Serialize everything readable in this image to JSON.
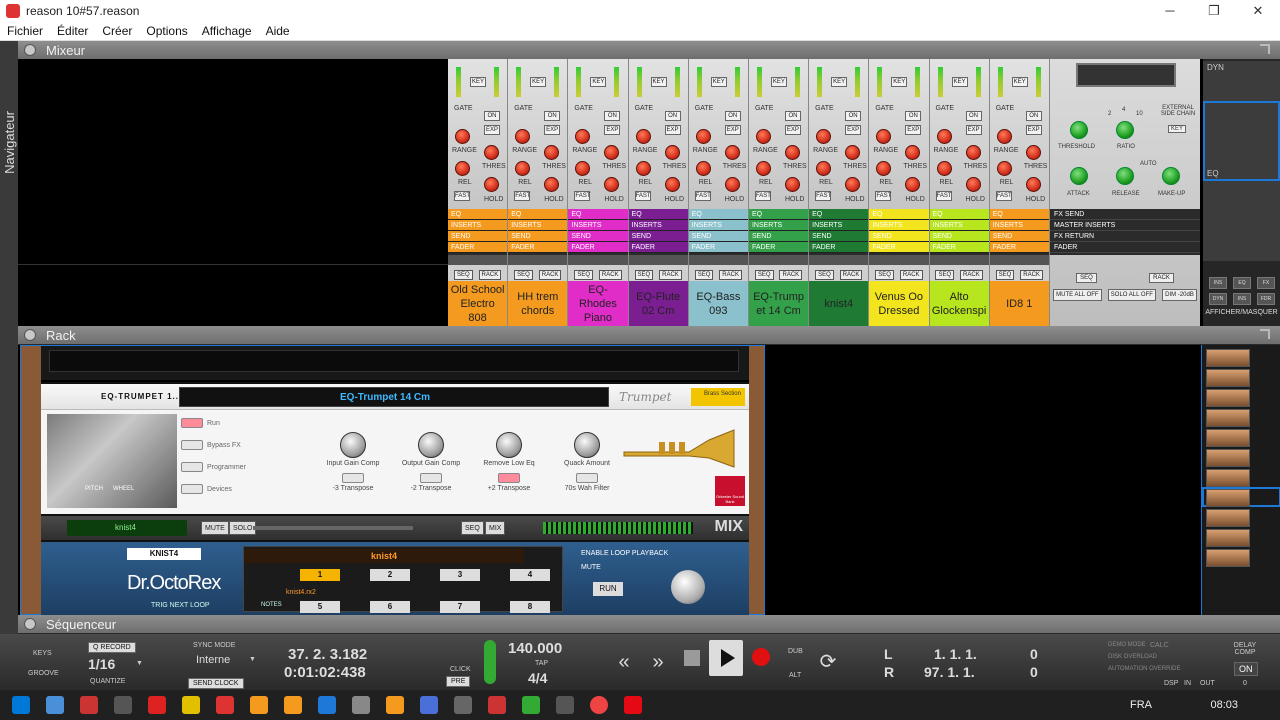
{
  "window": {
    "title": "reason 10#57.reason",
    "minimize": "─",
    "maximize": "❐",
    "close": "✕"
  },
  "menu": [
    "Fichier",
    "Éditer",
    "Créer",
    "Options",
    "Affichage",
    "Aide"
  ],
  "navigator": {
    "label": "Navigateur"
  },
  "sections": {
    "mixer": "Mixeur",
    "rack": "Rack",
    "sequencer": "Séquenceur"
  },
  "channel_labels": {
    "key": "KEY",
    "gate": "GATE",
    "on": "ON",
    "exp": "EXP",
    "range": "RANGE",
    "thres": "THRES",
    "rel": "REL",
    "hold": "HOLD",
    "fast": "FAST",
    "eq": "EQ",
    "inserts": "INSERTS",
    "send": "SEND",
    "fader": "FADER",
    "seq": "SEQ",
    "rack": "RACK"
  },
  "channels": [
    {
      "name": "Old School Electro 808",
      "color": "#f39a1f"
    },
    {
      "name": "HH trem chords",
      "color": "#f39a1f"
    },
    {
      "name": "EQ-Rhodes Piano",
      "color": "#e02dc8"
    },
    {
      "name": "EQ-Flute 02 Cm",
      "color": "#7a1e92"
    },
    {
      "name": "EQ-Bass 093",
      "color": "#8bc1cc"
    },
    {
      "name": "EQ-Trump et 14 Cm",
      "color": "#33a04a"
    },
    {
      "name": "knist4",
      "color": "#1f7a34"
    },
    {
      "name": "Venus Oo Dressed",
      "color": "#f2e51e"
    },
    {
      "name": "Alto Glockenspi",
      "color": "#b7e51e"
    },
    {
      "name": "ID8 1",
      "color": "#f39a1f"
    }
  ],
  "master": {
    "external_side_chain": "EXTERNAL SIDE CHAIN",
    "key": "KEY",
    "threshold": "THRESHOLD",
    "ratio": "RATIO",
    "attack": "ATTACK",
    "release": "RELEASE",
    "makeup": "MAKE-UP",
    "auto": "AUTO",
    "ratio_ticks": [
      "2",
      "4",
      "10"
    ],
    "fx_send": "FX SEND",
    "master_inserts": "MASTER INSERTS",
    "fx_return": "FX RETURN",
    "fader": "FADER",
    "seq": "SEQ",
    "rack": "RACK",
    "mute_all_off": "MUTE ALL OFF",
    "solo_all_off": "SOLO ALL OFF",
    "dim": "DIM -20dB"
  },
  "mixer_nav": {
    "dyn": "DYN",
    "eq": "EQ",
    "show_hide": "AFFICHER/MASQUER",
    "boxes": [
      "INS",
      "EQ",
      "FX",
      "DYN",
      "INS",
      "FDR"
    ]
  },
  "eq_device": {
    "title": "EQ-TRUMPET 1...",
    "patch_name": "EQ-Trumpet 14 Cm",
    "brand": "Trumpet",
    "badge": "Brass Section",
    "side": [
      "Run",
      "Bypass FX",
      "Programmer",
      "Devices"
    ],
    "pitch_label": "PITCH",
    "wheel_label": "WHEEL",
    "macros": [
      {
        "knob": "Input Gain Comp",
        "button": "-3 Transpose",
        "on": false
      },
      {
        "knob": "Output Gain Comp",
        "button": "-2 Transpose",
        "on": false
      },
      {
        "knob": "Remove Low Eq",
        "button": "+2 Transpose",
        "on": true
      },
      {
        "knob": "Quack Amount",
        "button": "70s Wah Filter",
        "on": false
      }
    ],
    "orchestra_logo": "Orkester Sound Bank"
  },
  "mix_strip": {
    "name": "knist4",
    "mute": "MUTE",
    "solo": "SOLO",
    "seq": "SEQ",
    "mix_btn": "MIX",
    "mix_label": "MIX"
  },
  "octorex": {
    "tag": "KNIST4",
    "logo": "Dr.OctoRex",
    "trig": "TRIG NEXT LOOP",
    "notes": "NOTES",
    "patch": "knist4",
    "slots": [
      "1",
      "2",
      "3",
      "4",
      "5",
      "6",
      "7",
      "8"
    ],
    "file": "knist4.rx2",
    "enable_loop": "ENABLE LOOP PLAYBACK",
    "mute": "MUTE",
    "run": "RUN"
  },
  "transport": {
    "keys": "KEYS",
    "groove": "GROOVE",
    "q_record": "Q RECORD",
    "quantize_value": "1/16",
    "quantize": "QUANTIZE",
    "sync_mode": "SYNC MODE",
    "sync_value": "Interne",
    "send_clock": "SEND CLOCK",
    "position": "37.  2.  3.182",
    "time": "0:01:02:438",
    "click": "CLICK",
    "pre": "PRE",
    "tempo": "140.000",
    "tap": "TAP",
    "signature": "4/4",
    "rewind": "«",
    "forward": "»",
    "dub": "DUB",
    "alt": "ALT",
    "loop": "⟳",
    "l_label": "L",
    "r_label": "R",
    "l_pos": "1.   1.   1.",
    "l_ticks": "0",
    "r_pos": "97.   1.   1.",
    "r_ticks": "0",
    "status": [
      "DEMO MODE",
      "DISK OVERLOAD",
      "AUTOMATION OVERRIDE"
    ],
    "calc": "CALC",
    "dsp": "DSP",
    "in": "IN",
    "out": "OUT",
    "delay_comp": "DELAY COMP",
    "delay_state": "ON",
    "delay_value": "0"
  },
  "taskbar": {
    "language": "FRA",
    "clock": "08:03"
  }
}
